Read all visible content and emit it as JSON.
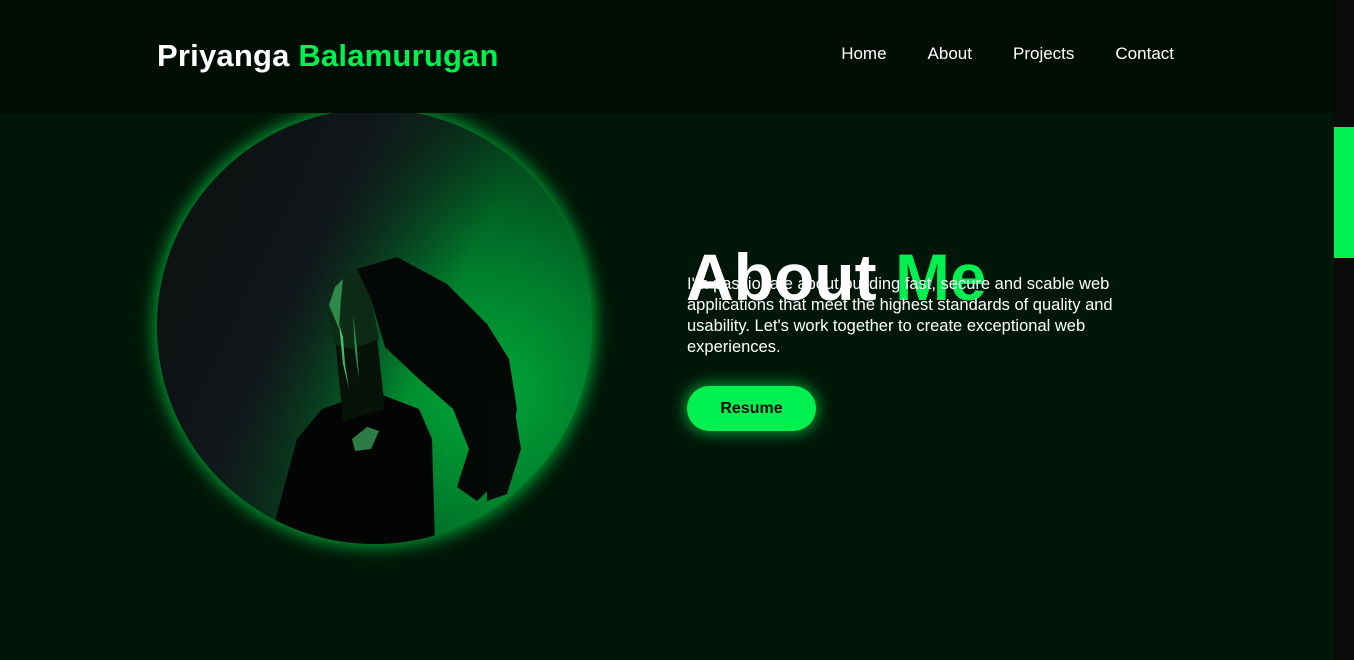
{
  "brand": {
    "first": "Priyanga",
    "last": "Balamurugan"
  },
  "nav": {
    "items": [
      "Home",
      "About",
      "Projects",
      "Contact"
    ]
  },
  "about": {
    "title_main": "About",
    "title_accent": "Me",
    "description": "I'm passionate about building fast, secure and scable web applications that meet the highest standards of quality and usability. Let's work together to create exceptional web experiences.",
    "button_label": "Resume"
  },
  "colors": {
    "accent": "#00f050",
    "background": "#001608",
    "header_background": "#000d04",
    "text": "#ffffff"
  },
  "profile_photo": {
    "icon": "profile-photo"
  }
}
